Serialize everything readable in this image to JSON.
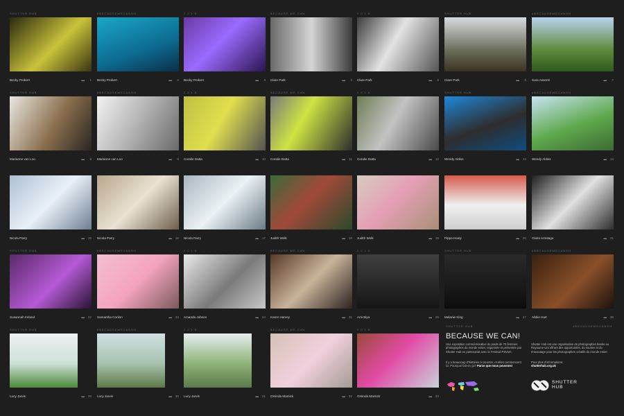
{
  "hashtag": "#BECAUSEWECANSH",
  "brand": "SHUTTER HUB",
  "year": "2 0 1 8",
  "because_we_can_header": "BECAUSE WE CAN",
  "photos": [
    {
      "name": "Becky Probert",
      "num": "1",
      "hdr_l": "SHUTTER HUB",
      "hdr_r": ""
    },
    {
      "name": "Becky Probert",
      "num": "2",
      "hdr_l": "#BECAUSEWECANSH",
      "hdr_r": ""
    },
    {
      "name": "Becky Probert",
      "num": "3",
      "hdr_l": "2 0 1 8",
      "hdr_r": ""
    },
    {
      "name": "Clare Park",
      "num": "4",
      "hdr_l": "BECAUSE WE CAN",
      "hdr_r": ""
    },
    {
      "name": "Clare Park",
      "num": "5",
      "hdr_l": "2 0 1 8",
      "hdr_r": ""
    },
    {
      "name": "Clare Park",
      "num": "6",
      "hdr_l": "SHUTTER HUB",
      "hdr_r": ""
    },
    {
      "name": "Sara Assenti",
      "num": "7",
      "hdr_l": "#BECAUSEWECANSH",
      "hdr_r": ""
    },
    {
      "name": "Marianne van Loo",
      "num": "8",
      "hdr_l": "SHUTTER HUB",
      "hdr_r": ""
    },
    {
      "name": "Marianne van Loo",
      "num": "9",
      "hdr_l": "#BECAUSEWECANSH",
      "hdr_r": ""
    },
    {
      "name": "Coralie Datta",
      "num": "10",
      "hdr_l": "2 0 1 8",
      "hdr_r": ""
    },
    {
      "name": "Coralie Datta",
      "num": "11",
      "hdr_l": "BECAUSE WE CAN",
      "hdr_r": ""
    },
    {
      "name": "Coralie Datta",
      "num": "12",
      "hdr_l": "2 0 1 8",
      "hdr_r": ""
    },
    {
      "name": "Wendy Aldiss",
      "num": "13",
      "hdr_l": "SHUTTER HUB",
      "hdr_r": ""
    },
    {
      "name": "Wendy Aldiss",
      "num": "14",
      "hdr_l": "#BECAUSEWECANSH",
      "hdr_r": ""
    },
    {
      "name": "Nicola Parry",
      "num": "15",
      "hdr_l": "",
      "hdr_r": ""
    },
    {
      "name": "Nicola Parry",
      "num": "16",
      "hdr_l": "",
      "hdr_r": ""
    },
    {
      "name": "Nicola Parry",
      "num": "17",
      "hdr_l": "",
      "hdr_r": ""
    },
    {
      "name": "Judith Wolk",
      "num": "18",
      "hdr_l": "",
      "hdr_r": ""
    },
    {
      "name": "Judith Wolk",
      "num": "19",
      "hdr_l": "",
      "hdr_r": ""
    },
    {
      "name": "Pippa Healy",
      "num": "20",
      "hdr_l": "",
      "hdr_r": ""
    },
    {
      "name": "Claire Armitage",
      "num": "21",
      "hdr_l": "",
      "hdr_r": ""
    },
    {
      "name": "Susannah Ireland",
      "num": "22",
      "hdr_l": "SHUTTER HUB",
      "hdr_r": ""
    },
    {
      "name": "Samantha Conlon",
      "num": "23",
      "hdr_l": "#BECAUSEWECANSH",
      "hdr_r": ""
    },
    {
      "name": "Amanda Jobson",
      "num": "24",
      "hdr_l": "2 0 1 8",
      "hdr_r": ""
    },
    {
      "name": "Karen Harvey",
      "num": "25",
      "hdr_l": "BECAUSE WE CAN",
      "hdr_r": ""
    },
    {
      "name": "Ami Biya",
      "num": "26",
      "hdr_l": "2 0 1 8",
      "hdr_r": ""
    },
    {
      "name": "Melanie King",
      "num": "27",
      "hdr_l": "SHUTTER HUB",
      "hdr_r": ""
    },
    {
      "name": "Abbie Hart",
      "num": "28",
      "hdr_l": "#BECAUSEWECANSH",
      "hdr_r": ""
    },
    {
      "name": "Lucy Jarvis",
      "num": "29",
      "hdr_l": "SHUTTER HUB",
      "hdr_r": ""
    },
    {
      "name": "Lucy Jarvis",
      "num": "30",
      "hdr_l": "#BECAUSEWECANSH",
      "hdr_r": ""
    },
    {
      "name": "Lucy Jarvis",
      "num": "31",
      "hdr_l": "2 0 1 8",
      "hdr_r": ""
    },
    {
      "name": "Orsinda Marsick",
      "num": "32",
      "hdr_l": "BECAUSE WE CAN",
      "hdr_r": ""
    },
    {
      "name": "Orsinda Marsick",
      "num": "33",
      "hdr_l": "2 0 1 8",
      "hdr_r": ""
    }
  ],
  "info": {
    "hdr_l": "SHUTTER HUB",
    "hdr_r": "#BECAUSEWECANSH",
    "title": "BECAUSE WE CAN!",
    "p1": "Une exposition commémorative du poids de 70 femmes photographes du monde entier, organisée et présentée par Shutter Hub en partenariat avec le Festival PSVom.",
    "p2": "Il y a beaucoup d'histoires à raconter, et elles commencent ici. Pourquoi fait-on ça?",
    "p2b": "Parce que nous pouvons!",
    "p3": "Shutter Hub est une organisation de photographes basée au Royaume-Uni offrant des opportunités, du soutien et du réseautage pour les photographes créatifs du monde entier.",
    "p4": "Pour plus d'informations:",
    "p4b": "shutterhub.org.uk",
    "logo_l1": "SHUTTER",
    "logo_l2": "HUB"
  },
  "colors": {
    "bg": "#1e1e1e",
    "text": "#cfcfcf"
  }
}
